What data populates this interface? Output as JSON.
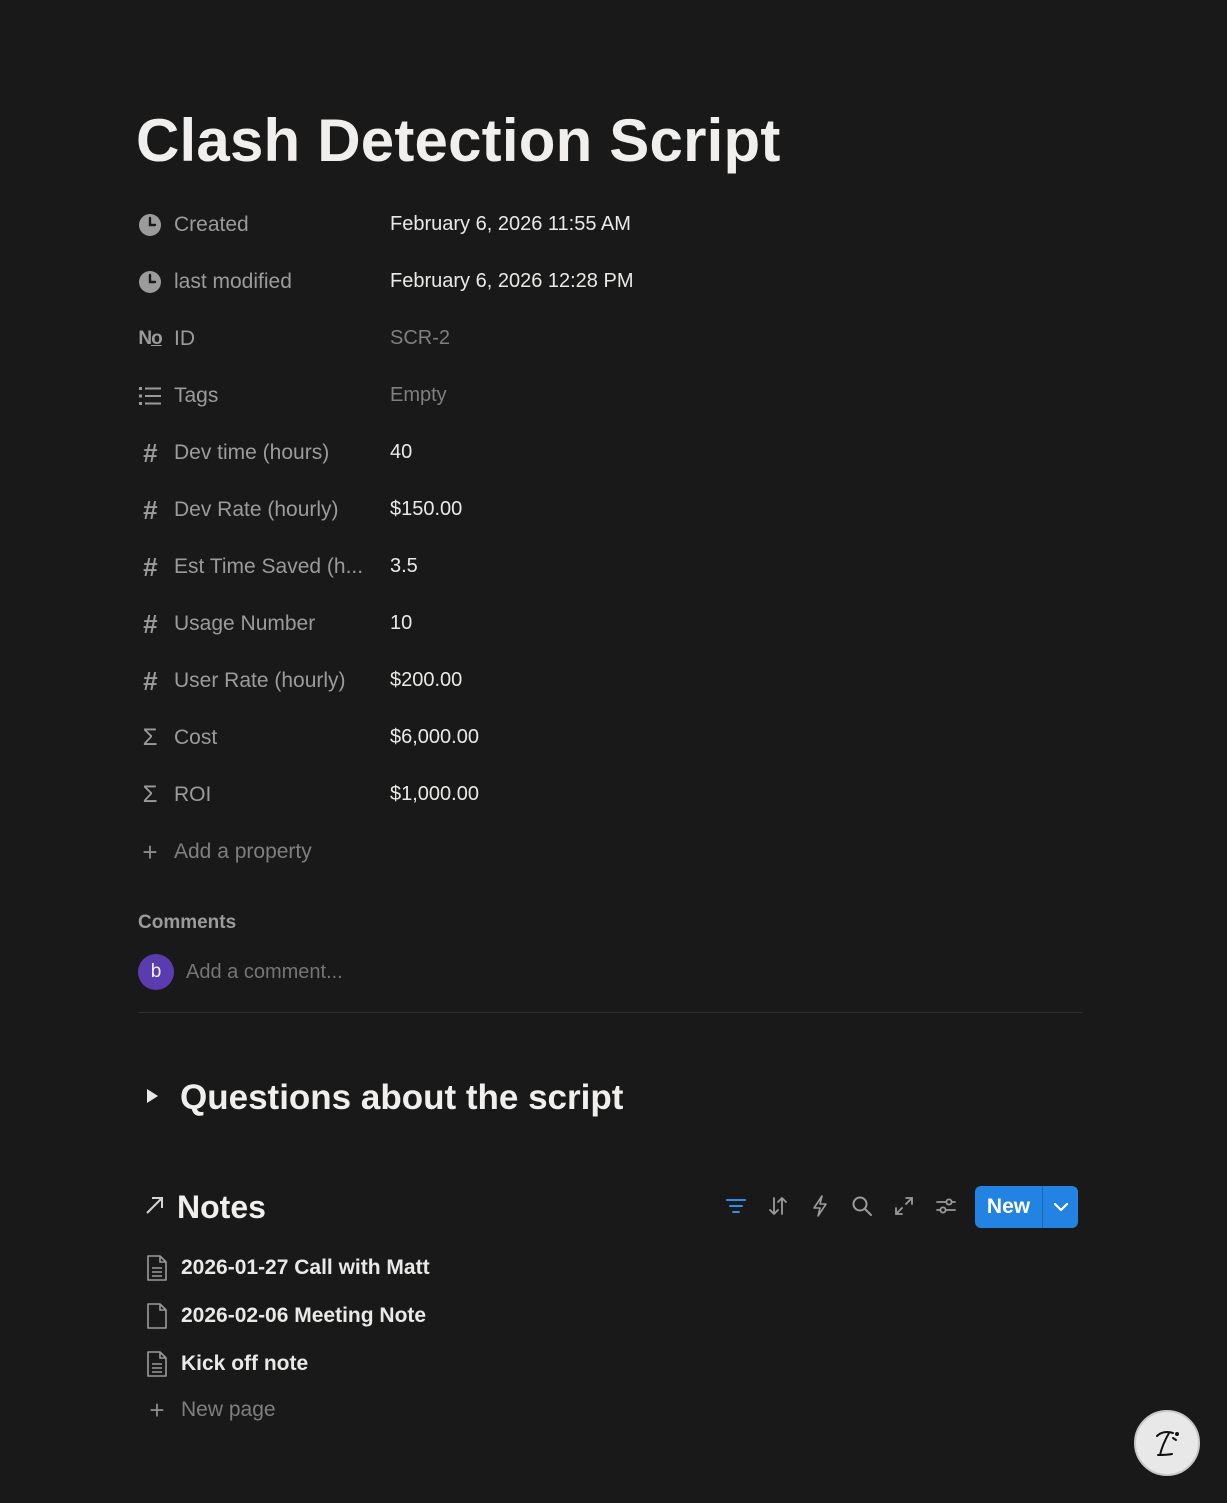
{
  "page": {
    "title": "Clash Detection Script"
  },
  "properties": [
    {
      "icon": "clock-icon",
      "name": "Created",
      "value": "February 6, 2026 11:55 AM",
      "muted": false
    },
    {
      "icon": "clock-icon",
      "name": "last modified",
      "value": "February 6, 2026 12:28 PM",
      "muted": false
    },
    {
      "icon": "numero-icon",
      "name": "ID",
      "value": "SCR-2",
      "muted": true
    },
    {
      "icon": "list-icon",
      "name": "Tags",
      "value": "Empty",
      "muted": true
    },
    {
      "icon": "hash-icon",
      "name": "Dev time (hours)",
      "value": "40",
      "muted": false
    },
    {
      "icon": "hash-icon",
      "name": "Dev Rate (hourly)",
      "value": "$150.00",
      "muted": false
    },
    {
      "icon": "hash-icon",
      "name": "Est Time Saved (h...",
      "value": "3.5",
      "muted": false
    },
    {
      "icon": "hash-icon",
      "name": "Usage Number",
      "value": "10",
      "muted": false
    },
    {
      "icon": "hash-icon",
      "name": "User Rate (hourly)",
      "value": "$200.00",
      "muted": false
    },
    {
      "icon": "sigma-icon",
      "name": "Cost",
      "value": "$6,000.00",
      "muted": false
    },
    {
      "icon": "sigma-icon",
      "name": "ROI",
      "value": "$1,000.00",
      "muted": false
    }
  ],
  "add_property": {
    "icon": "plus-icon",
    "label": "Add a property"
  },
  "comments": {
    "label": "Comments",
    "avatar_letter": "b",
    "placeholder": "Add a comment..."
  },
  "toggle": {
    "icon": "triangle-right-icon",
    "title": "Questions about the script"
  },
  "notes": {
    "icon": "arrow-up-right-icon",
    "title": "Notes",
    "toolbar": [
      {
        "icon": "filter-icon",
        "active": true
      },
      {
        "icon": "sort-icon",
        "active": false
      },
      {
        "icon": "lightning-icon",
        "active": false
      },
      {
        "icon": "search-icon",
        "active": false
      },
      {
        "icon": "expand-icon",
        "active": false
      },
      {
        "icon": "settings-sliders-icon",
        "active": false
      }
    ],
    "new_button_label": "New",
    "items": [
      {
        "icon": "document-lines-icon",
        "label": "2026-01-27 Call with Matt"
      },
      {
        "icon": "document-blank-icon",
        "label": "2026-02-06 Meeting Note"
      },
      {
        "icon": "document-lines-icon",
        "label": "Kick off note"
      }
    ],
    "new_page_label": "New page"
  },
  "assistant_button": {
    "icon": "notion-ai-face-icon"
  },
  "colors": {
    "background": "#191919",
    "accent": "#2383e2",
    "avatar": "#5a3bb0"
  }
}
